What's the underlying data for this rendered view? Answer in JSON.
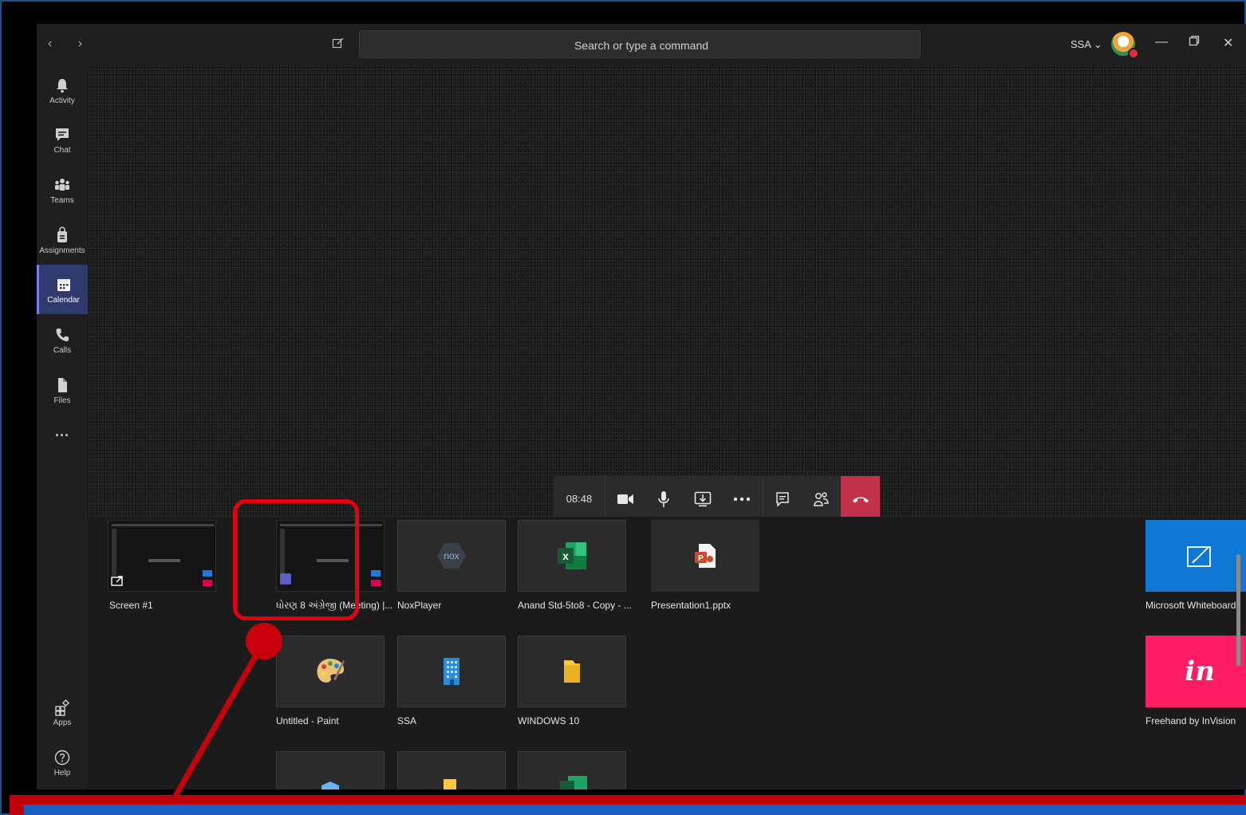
{
  "titlebar": {
    "search_placeholder": "Search or type a command",
    "user_label": "SSA ⌄",
    "nav_arrows": "‹  ›"
  },
  "rail": {
    "items": [
      {
        "label": "Activity",
        "icon": "bell-icon"
      },
      {
        "label": "Chat",
        "icon": "chat-icon"
      },
      {
        "label": "Teams",
        "icon": "teams-icon"
      },
      {
        "label": "Assignments",
        "icon": "assignments-icon"
      },
      {
        "label": "Calendar",
        "icon": "calendar-icon",
        "active": true
      },
      {
        "label": "Calls",
        "icon": "phone-icon"
      },
      {
        "label": "Files",
        "icon": "file-icon"
      },
      {
        "label": "···",
        "icon": "more-icon"
      }
    ],
    "bottom": [
      {
        "label": "Apps",
        "icon": "apps-icon"
      },
      {
        "label": "Help",
        "icon": "help-icon"
      }
    ]
  },
  "call": {
    "timer": "08:48",
    "hangup_color": "#c4314b"
  },
  "share_tray": {
    "row1": [
      {
        "label": "Screen #1",
        "kind": "screen"
      },
      {
        "label": "ધોરણ 8 અંગ્રેજી (Meeting) |...",
        "kind": "window",
        "highlighted": true
      },
      {
        "label": "NoxPlayer",
        "icon": "nox-icon"
      },
      {
        "label": "Anand Std-5to8 - Copy - ...",
        "icon": "excel-icon"
      },
      {
        "label": "Presentation1.pptx",
        "icon": "powerpoint-icon"
      }
    ],
    "row2": [
      {
        "label": "Untitled - Paint",
        "icon": "paint-icon"
      },
      {
        "label": "SSA",
        "icon": "building-icon"
      },
      {
        "label": "WINDOWS 10",
        "icon": "folder-icon"
      }
    ],
    "apps": [
      {
        "label": "Microsoft Whiteboard",
        "color": "#0f78d4",
        "icon": "whiteboard-icon"
      },
      {
        "label": "Freehand by InVision",
        "color": "#ff1e64",
        "icon": "invision-icon",
        "glyph": "in"
      }
    ]
  },
  "annotation_color": "#e3000f"
}
